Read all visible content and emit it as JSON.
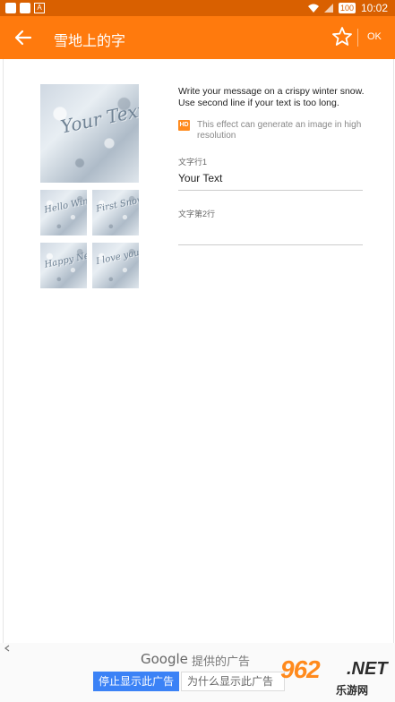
{
  "status_bar": {
    "time": "10:02",
    "app_icon_letter": "A",
    "icons": [
      "wifi-icon",
      "signal-icon",
      "battery-icon"
    ],
    "battery": "100"
  },
  "app_bar": {
    "title": "雪地上的字",
    "ok_label": "OK",
    "background_color": "#ff7a0d",
    "icons": [
      "back-arrow-icon",
      "star-icon"
    ]
  },
  "content": {
    "main_thumbnail_text": "Your Text",
    "thumbnails": [
      {
        "text": "Hello Winter"
      },
      {
        "text": "First Snow"
      },
      {
        "text": "Happy New Year"
      },
      {
        "text": "I love you"
      }
    ],
    "description": "Write your message on a crispy winter snow. Use second line if your text is too long.",
    "hd_badge": "HD",
    "hd_note": "This effect can generate an image in high resolution",
    "field1": {
      "label": "文字行1",
      "value": "Your Text"
    },
    "field2": {
      "label": "文字第2行",
      "value": ""
    }
  },
  "ad": {
    "google_label": "Google",
    "provided_label": "提供的广告",
    "stop_label": "停止显示此广告",
    "why_label": "为什么显示此广告",
    "logo_number": "962",
    "logo_net": ".NET",
    "logo_sub": "乐游网",
    "accent_color": "#3b82f6"
  }
}
